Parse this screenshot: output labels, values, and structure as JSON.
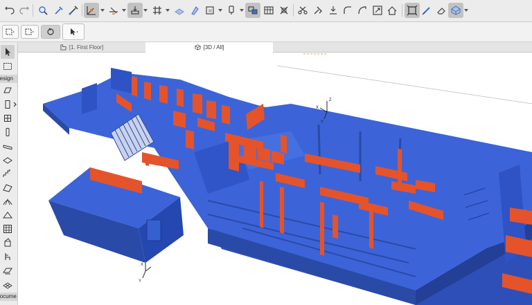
{
  "tabs": [
    {
      "label": "[1. First Floor]"
    },
    {
      "label": "[3D / All]"
    }
  ],
  "toolbox": {
    "design_label": "Design",
    "document_label": "Docume"
  },
  "colors": {
    "slab": "#3c64d8",
    "slab_dark": "#2a4aa8",
    "wall_blue": "#2f4fc2",
    "wall_red": "#e5532b",
    "toolbar_bg": "#ececec",
    "active_btn": "#c2c2c2"
  },
  "icons": [
    "undo-icon",
    "redo-icon",
    "arrow-select-icon",
    "eyedropper-icon",
    "inject-icon",
    "snap-guides-icon",
    "guide-lines-icon",
    "gravity-icon",
    "grid-snap-icon",
    "suspend-groups-icon",
    "layer-icon",
    "renovation-icon",
    "trace-icon",
    "teamwork-icon",
    "section-marker-icon",
    "split-icon",
    "adjust-icon",
    "offset-icon",
    "fillet-icon",
    "resize-icon",
    "roof-icon",
    "pointer-icon",
    "3d-cube-icon",
    "floor-plan-icon",
    "orbit-icon"
  ]
}
